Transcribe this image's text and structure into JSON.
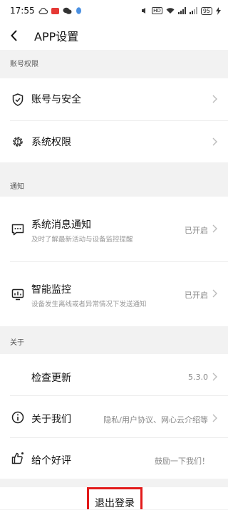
{
  "status_bar": {
    "time": "17:55",
    "battery": "95",
    "hd": "HD"
  },
  "header": {
    "title": "APP设置"
  },
  "sections": {
    "account": {
      "label": "账号权限",
      "items": [
        {
          "title": "账号与安全"
        },
        {
          "title": "系统权限"
        }
      ]
    },
    "notice": {
      "label": "通知",
      "items": [
        {
          "title": "系统消息通知",
          "subtitle": "及时了解最新活动与设备监控提醒",
          "value": "已开启"
        },
        {
          "title": "智能监控",
          "subtitle": "设备发生离线或者异常情况下发送通知",
          "value": "已开启"
        }
      ]
    },
    "about": {
      "label": "关于",
      "items": [
        {
          "title": "检查更新",
          "value": "5.3.0"
        },
        {
          "title": "关于我们",
          "value": "隐私/用户协议、网心云介绍等"
        },
        {
          "title": "给个好评",
          "value": "鼓励一下我们！"
        }
      ]
    }
  },
  "logout": {
    "label": "退出登录"
  },
  "colors": {
    "accent": "#e21a1a",
    "background": "#f2f2f2"
  }
}
